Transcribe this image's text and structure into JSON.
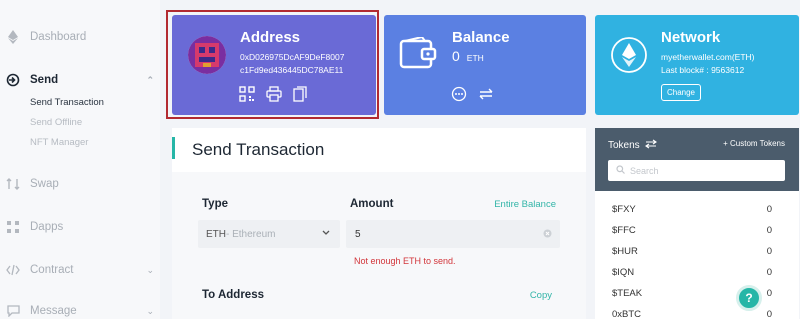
{
  "sidebar": {
    "items": [
      {
        "label": "Dashboard",
        "icon": "ethereum-icon"
      },
      {
        "label": "Send",
        "icon": "send-icon"
      },
      {
        "label": "Swap",
        "icon": "swap-icon"
      },
      {
        "label": "Dapps",
        "icon": "dapps-icon"
      },
      {
        "label": "Contract",
        "icon": "contract-icon"
      },
      {
        "label": "Message",
        "icon": "message-icon"
      }
    ],
    "send_sub": [
      "Send Transaction",
      "Send Offline",
      "NFT Manager"
    ]
  },
  "address_card": {
    "title": "Address",
    "address_line1": "0xD026975DcAF9DeF8007",
    "address_line2": "c1Fd9ed436445DC78AE11"
  },
  "balance_card": {
    "title": "Balance",
    "amount": "0",
    "unit": "ETH"
  },
  "network_card": {
    "title": "Network",
    "network": "myetherwallet.com(ETH)",
    "last_block": "Last block# : 9563612",
    "change_label": "Change"
  },
  "send_panel": {
    "title": "Send Transaction",
    "type_label": "Type",
    "type_value": "ETH",
    "type_value_sub": " - Ethereum",
    "amount_label": "Amount",
    "entire_balance": "Entire Balance",
    "amount_value": "5",
    "error": "Not enough ETH to send.",
    "to_address_label": "To Address",
    "copy_label": "Copy"
  },
  "tokens": {
    "title": "Tokens",
    "custom": "+ Custom Tokens",
    "search_placeholder": "Search",
    "rows": [
      {
        "name": "$FXY",
        "value": "0"
      },
      {
        "name": "$FFC",
        "value": "0"
      },
      {
        "name": "$HUR",
        "value": "0"
      },
      {
        "name": "$IQN",
        "value": "0"
      },
      {
        "name": "$TEAK",
        "value": "0"
      },
      {
        "name": "0xBTC",
        "value": "0"
      }
    ]
  },
  "help_label": "?",
  "colors": {
    "address_card": "#6a6ad6",
    "balance_card": "#5b80e2",
    "network_card": "#30b2e1",
    "accent": "#26b6a7",
    "error": "#d2353a",
    "highlight_border": "#b22a31"
  }
}
